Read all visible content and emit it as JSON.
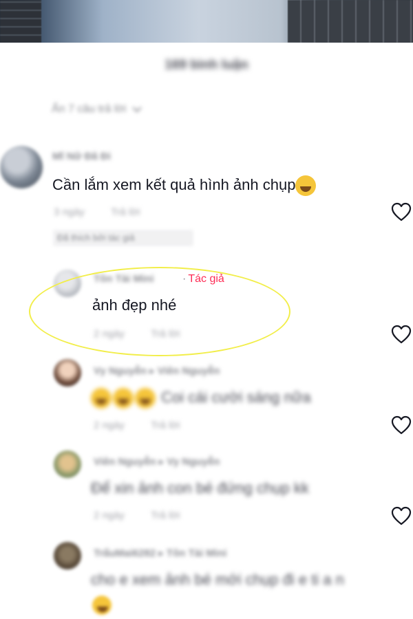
{
  "header": {
    "title": "169 bình luận"
  },
  "thread": {
    "hide_replies_label": "Ẩn 7 câu trả lời"
  },
  "comments": [
    {
      "username": "Mĩ Nữ Đã Đi",
      "text": "Cần lắm xem kết quả hình ảnh chụp",
      "emoji": "tears-of-joy",
      "time": "3 ngày",
      "reply": "Trả lời",
      "pin_label": "Đã thích bởi tác giả"
    },
    {
      "username": "Tôn Tài Mini",
      "badge_separator": "·",
      "badge": "Tác giả",
      "text": "ảnh đẹp nhé",
      "time": "2 ngày",
      "reply": "Trả lời"
    },
    {
      "username": "Vy Nguyễn ▸ Viên Nguyễn",
      "text": "Coi cái cười sáng nữa",
      "time": "2 ngày",
      "reply": "Trả lời"
    },
    {
      "username": "Viên Nguyễn ▸ Vy Nguyễn",
      "text": "Để xin ảnh con bé đứng chụp kk",
      "time": "2 ngày",
      "reply": "Trả lời"
    },
    {
      "username": "TrẩuMai6282 ▸ Tôn Tài Mini",
      "text": "cho e xem ảnh bé mới chụp đi e ti a n"
    }
  ],
  "colors": {
    "accent": "#fe2c55",
    "highlight": "#f2ee4a",
    "text": "#161823",
    "secondary": "#8a8b91"
  },
  "icons": {
    "like": "heart-outline-icon",
    "expand": "chevron-down-icon",
    "emoji": "laughing-emoji-icon"
  }
}
